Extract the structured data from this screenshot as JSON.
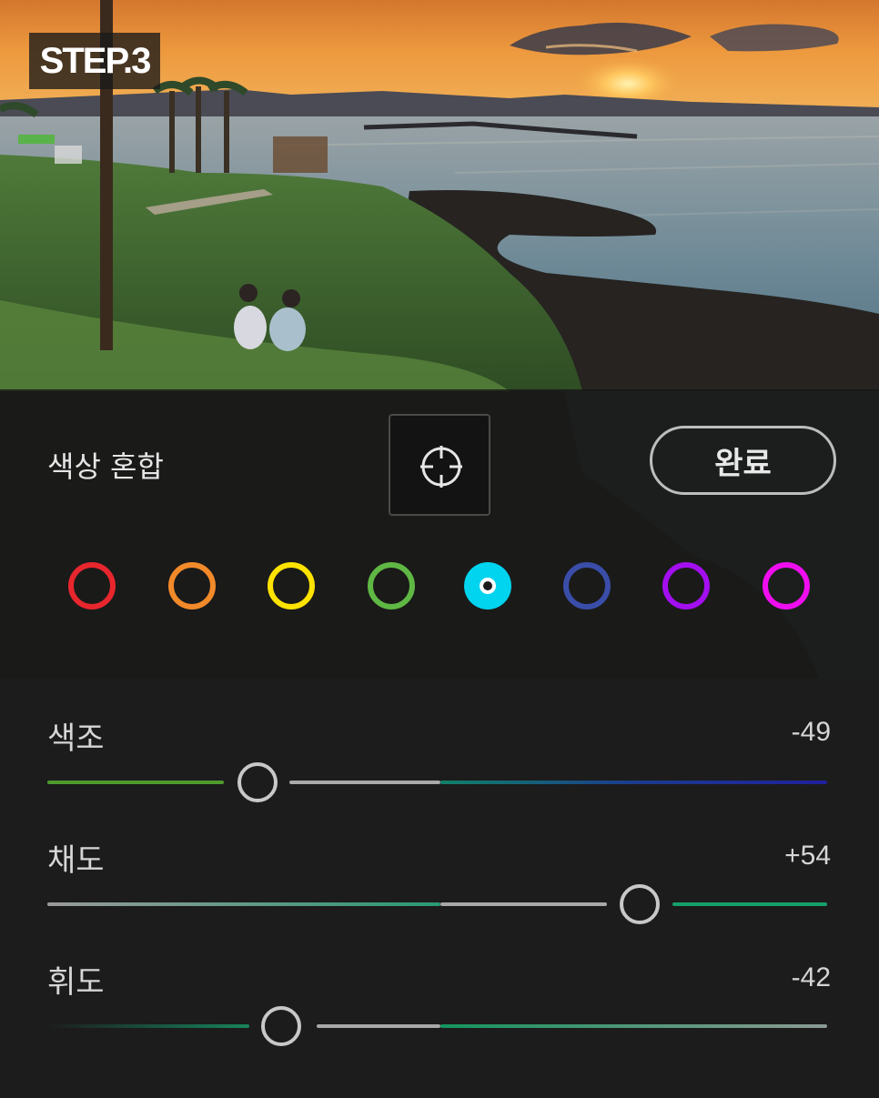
{
  "badge": "STEP.3",
  "panel": {
    "title": "색상 혼합",
    "target_icon": "target-crosshair-icon",
    "done_label": "완료"
  },
  "colors": [
    {
      "name": "red",
      "hex": "#e8262d"
    },
    {
      "name": "orange",
      "hex": "#f38a2a"
    },
    {
      "name": "yellow",
      "hex": "#ffe300"
    },
    {
      "name": "green",
      "hex": "#5fb843"
    },
    {
      "name": "aqua",
      "hex": "#00d4ee",
      "selected": true
    },
    {
      "name": "blue",
      "hex": "#3a4ea9"
    },
    {
      "name": "purple",
      "hex": "#a30ff0"
    },
    {
      "name": "magenta",
      "hex": "#f00ef0"
    }
  ],
  "sliders": [
    {
      "label": "색조",
      "value": "-49",
      "fraction": 0.27
    },
    {
      "label": "채도",
      "value": "+54",
      "fraction": 0.76
    },
    {
      "label": "휘도",
      "value": "-42",
      "fraction": 0.3
    }
  ]
}
